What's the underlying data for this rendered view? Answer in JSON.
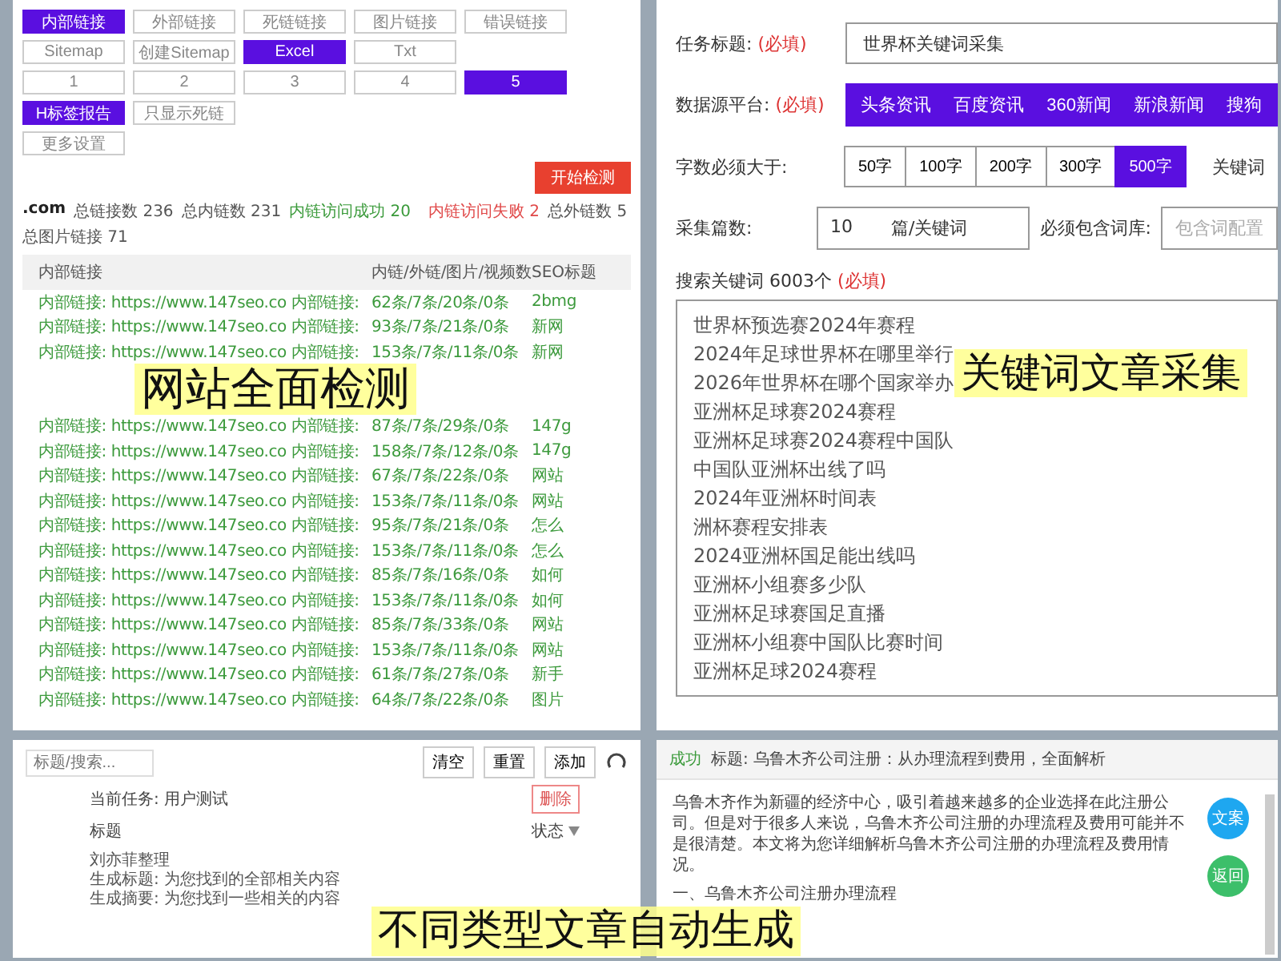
{
  "captions": [
    "网站全面检测",
    "关键词文章采集",
    "不同类型文章自动生成"
  ],
  "link_checker": {
    "option_rows": [
      [
        {
          "label": "内部链接",
          "selected": true
        },
        {
          "label": "外部链接",
          "selected": false
        },
        {
          "label": "死链链接",
          "selected": false
        },
        {
          "label": "图片链接",
          "selected": false
        },
        {
          "label": "错误链接",
          "selected": false
        }
      ],
      [
        {
          "label": "Sitemap",
          "selected": false
        },
        {
          "label": "创建Sitemap",
          "selected": false
        },
        {
          "label": "Excel",
          "selected": true
        },
        {
          "label": "Txt",
          "selected": false
        }
      ],
      [
        {
          "label": "1",
          "selected": false
        },
        {
          "label": "2",
          "selected": false
        },
        {
          "label": "3",
          "selected": false
        },
        {
          "label": "4",
          "selected": false
        },
        {
          "label": "5",
          "selected": true
        }
      ],
      [
        {
          "label": "H标签报告",
          "selected": true
        },
        {
          "label": "只显示死链",
          "selected": false
        }
      ],
      [
        {
          "label": "更多设置",
          "selected": false
        }
      ]
    ],
    "start_button": "开始检测",
    "stats": [
      {
        "text": ".com",
        "kind": "domain"
      },
      {
        "text": "总链接数 236",
        "kind": "plain"
      },
      {
        "text": "总内链数 231",
        "kind": "plain"
      },
      {
        "text": "内链访问成功 20",
        "kind": "ok"
      },
      {
        "text": "内链访问失败 2",
        "kind": "fail"
      },
      {
        "text": "总外链数 5",
        "kind": "plain"
      },
      {
        "text": "总图片链接 71",
        "kind": "plain"
      }
    ],
    "table": {
      "columns": [
        "内部链接",
        "内链/外链/图片/视频数",
        "SEO标题"
      ],
      "rows": [
        {
          "link": "内部链接: https://www.147seo.co 内部链接:",
          "counts": "62条/7条/20条/0条",
          "column_4": "2bmg"
        },
        {
          "link": "内部链接: https://www.147seo.co 内部链接:",
          "counts": "93条/7条/21条/0条",
          "column_4": "新网"
        },
        {
          "link": "内部链接: https://www.147seo.co 内部链接:",
          "counts": "153条/7条/11条/0条",
          "column_4": "新网"
        },
        {
          "link": "内部链接: https://www.147seo.co 内部链接:",
          "counts": "87条/7条/29条/0条",
          "column_4": "147g"
        },
        {
          "link": "内部链接: https://www.147seo.co 内部链接:",
          "counts": "158条/7条/12条/0条",
          "column_4": "147g"
        },
        {
          "link": "内部链接: https://www.147seo.co 内部链接:",
          "counts": "67条/7条/22条/0条",
          "column_4": "网站"
        },
        {
          "link": "内部链接: https://www.147seo.co 内部链接:",
          "counts": "153条/7条/11条/0条",
          "column_4": "网站"
        },
        {
          "link": "内部链接: https://www.147seo.co 内部链接:",
          "counts": "95条/7条/21条/0条",
          "column_4": "怎么"
        },
        {
          "link": "内部链接: https://www.147seo.co 内部链接:",
          "counts": "153条/7条/11条/0条",
          "column_4": "怎么"
        },
        {
          "link": "内部链接: https://www.147seo.co 内部链接:",
          "counts": "85条/7条/16条/0条",
          "column_4": "如何"
        },
        {
          "link": "内部链接: https://www.147seo.co 内部链接:",
          "counts": "153条/7条/11条/0条",
          "column_4": "如何"
        },
        {
          "link": "内部链接: https://www.147seo.co 内部链接:",
          "counts": "85条/7条/33条/0条",
          "column_4": "网站"
        },
        {
          "link": "内部链接: https://www.147seo.co 内部链接:",
          "counts": "153条/7条/11条/0条",
          "column_4": "网站"
        },
        {
          "link": "内部链接: https://www.147seo.co 内部链接:",
          "counts": "61条/7条/27条/0条",
          "column_4": "新手"
        },
        {
          "link": "内部链接: https://www.147seo.co 内部链接:",
          "counts": "64条/7条/22条/0条",
          "column_4": "图片"
        }
      ]
    }
  },
  "collector": {
    "title_label": "任务标题:",
    "title_required": "(必填)",
    "source_required": "(必填)",
    "keywords_required": "(必填)",
    "title_value": "世界杯关键词采集",
    "source_label": "数据源平台:",
    "sources": [
      "头条资讯",
      "百度资讯",
      "360新闻",
      "新浪新闻",
      "搜狗"
    ],
    "length_label": "字数必须大于:",
    "lengths": [
      {
        "label": "50字",
        "selected": false
      },
      {
        "label": "100字",
        "selected": false
      },
      {
        "label": "200字",
        "selected": false
      },
      {
        "label": "300字",
        "selected": false
      },
      {
        "label": "500字",
        "selected": true
      }
    ],
    "length_extra": "关键词",
    "count_label": "采集篇数:",
    "count_value": "10",
    "count_unit": "篇/关键词",
    "include_label": "必须包含词库:",
    "include_placeholder": "包含词配置",
    "keywords_label": "搜索关键词 6003个",
    "keywords": [
      "世界杯预选赛2024年赛程",
      "2024年足球世界杯在哪里举行",
      "2026年世界杯在哪个国家举办",
      "亚洲杯足球赛2024赛程",
      "亚洲杯足球赛2024赛程中国队",
      "中国队亚洲杯出线了吗",
      "2024年亚洲杯时间表",
      "洲杯赛程安排表",
      "2024亚洲杯国足能出线吗",
      "亚洲杯小组赛多少队",
      "亚洲杯足球赛国足直播",
      "亚洲杯小组赛中国队比赛时间",
      "亚洲杯足球2024赛程"
    ]
  },
  "task_list": {
    "search_placeholder": "标题/搜索...",
    "buttons": [
      "清空",
      "重置",
      "添加"
    ],
    "current_task": "当前任务: 用户测试",
    "delete_tag": "删除",
    "columns": [
      "标题",
      "状态"
    ],
    "items": [
      {
        "title": "刘亦菲整理",
        "lines": [
          "生成标题: 为您找到的全部相关内容",
          "生成摘要: 为您找到一些相关的内容"
        ]
      }
    ]
  },
  "article": {
    "status": "成功",
    "title": "标题: 乌鲁木齐公司注册：从办理流程到费用，全面解析",
    "paragraph": "乌鲁木齐作为新疆的经济中心，吸引着越来越多的企业选择在此注册公司。但是对于很多人来说，乌鲁木齐公司注册的办理流程及费用可能并不是很清楚。本文将为您详细解析乌鲁木齐公司注册的办理流程及费用情况。",
    "heading": "一、乌鲁木齐公司注册办理流程",
    "side_buttons": [
      {
        "label": "文案",
        "color": "#1ea7f0"
      },
      {
        "label": "返回",
        "color": "#3cbf6a"
      }
    ]
  }
}
